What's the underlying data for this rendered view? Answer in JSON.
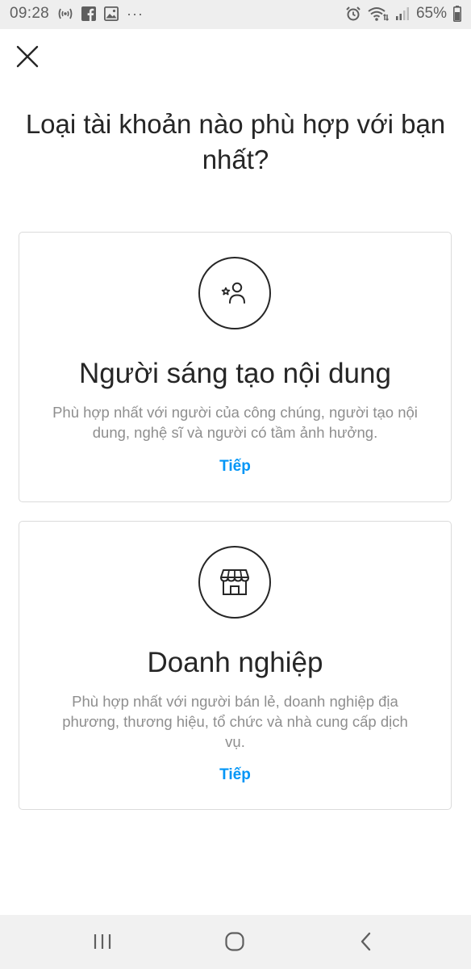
{
  "status_bar": {
    "time": "09:28",
    "notification_icons": [
      "nfc-icon",
      "facebook-icon",
      "gallery-icon",
      "more-dots-icon"
    ],
    "more": "···",
    "battery": "65%"
  },
  "header": {
    "close_icon": "close-icon",
    "title": "Loại tài khoản nào phù hợp với bạn nhất?"
  },
  "cards": [
    {
      "icon": "creator-star-person-icon",
      "title": "Người sáng tạo nội dung",
      "description": "Phù hợp nhất với người của công chúng, người tạo nội dung, nghệ sĩ và người có tầm ảnh hưởng.",
      "action": "Tiếp"
    },
    {
      "icon": "shop-storefront-icon",
      "title": "Doanh nghiệp",
      "description": "Phù hợp nhất với người bán lẻ, doanh nghiệp địa phương, thương hiệu, tổ chức và nhà cung cấp dịch vụ.",
      "action": "Tiếp"
    }
  ],
  "nav_bar": {
    "recent_apps": "recent-apps-icon",
    "home": "home-icon",
    "back": "back-icon"
  },
  "colors": {
    "link": "#0095f6",
    "text": "#262626",
    "secondary_text": "#8e8e8e",
    "border": "#dbdbdb"
  }
}
